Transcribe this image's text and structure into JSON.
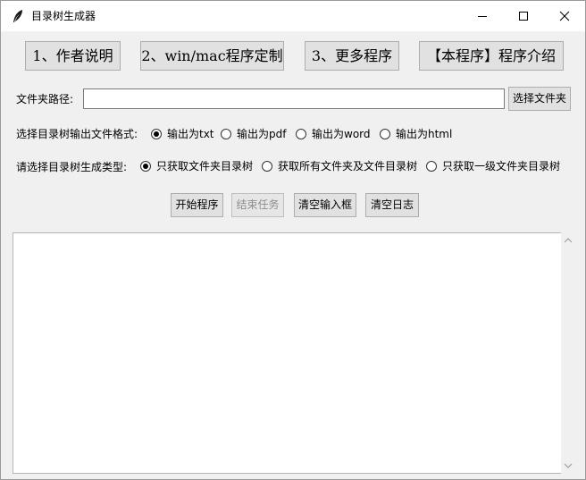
{
  "window": {
    "title": "目录树生成器",
    "icon": "feather-icon"
  },
  "top_menu": [
    {
      "label": "1、作者说明"
    },
    {
      "label": "2、win/mac程序定制"
    },
    {
      "label": "3、更多程序"
    },
    {
      "label": "【本程序】程序介绍"
    }
  ],
  "folder": {
    "label": "文件夹路径:",
    "value": "",
    "browse_label": "选择文件夹"
  },
  "format": {
    "label": "选择目录树输出文件格式:",
    "options": [
      "输出为txt",
      "输出为pdf",
      "输出为word",
      "输出为html"
    ],
    "selected": 0
  },
  "tree_type": {
    "label": "请选择目录树生成类型:",
    "options": [
      "只获取文件夹目录树",
      "获取所有文件夹及文件目录树",
      "只获取一级文件夹目录树"
    ],
    "selected": 0
  },
  "actions": {
    "start": "开始程序",
    "stop": "结束任务",
    "clear_input": "清空输入框",
    "clear_log": "清空日志"
  },
  "log": {
    "content": ""
  }
}
